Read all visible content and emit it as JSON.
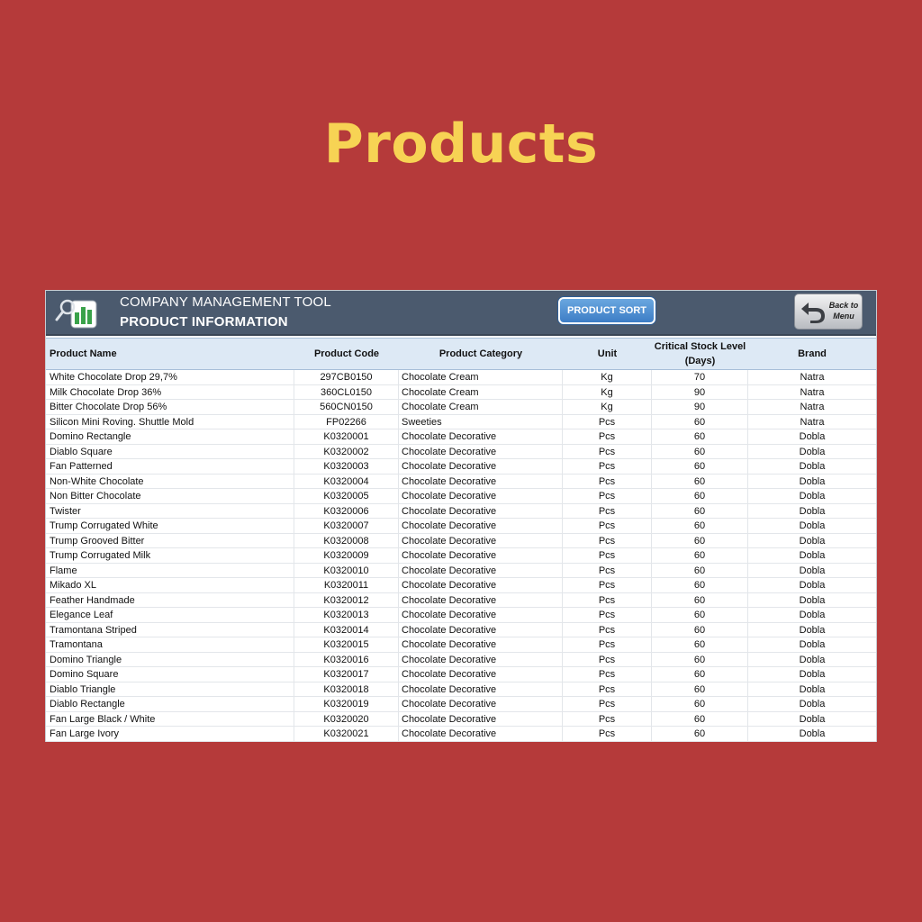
{
  "page": {
    "title": "Products"
  },
  "app": {
    "title_line1": "COMPANY MANAGEMENT TOOL",
    "title_line2": "PRODUCT INFORMATION",
    "logo_icon": "chart-magnifier-icon",
    "sort_button_label": "PRODUCT SORT",
    "back_button_label_line1": "Back to",
    "back_button_label_line2": "Menu",
    "back_icon": "back-arrow-icon"
  },
  "colors": {
    "background": "#b53a3a",
    "title": "#f7d354",
    "header_bar": "#4b5a6e",
    "table_header": "#dde9f5",
    "sort_button": "#3d7dc6"
  },
  "table": {
    "columns": {
      "name": "Product Name",
      "code": "Product Code",
      "category": "Product Category",
      "unit": "Unit",
      "critical_line1": "Critical Stock Level",
      "critical_line2": "(Days)",
      "brand": "Brand"
    },
    "rows": [
      {
        "name": "White Chocolate Drop 29,7%",
        "code": "297CB0150",
        "category": "Chocolate Cream",
        "unit": "Kg",
        "critical": "70",
        "brand": "Natra"
      },
      {
        "name": "Milk Chocolate Drop 36%",
        "code": "360CL0150",
        "category": "Chocolate Cream",
        "unit": "Kg",
        "critical": "90",
        "brand": "Natra"
      },
      {
        "name": "Bitter Chocolate Drop 56%",
        "code": "560CN0150",
        "category": "Chocolate Cream",
        "unit": "Kg",
        "critical": "90",
        "brand": "Natra"
      },
      {
        "name": "Silicon Mini Roving. Shuttle Mold",
        "code": "FP02266",
        "category": "Sweeties",
        "unit": "Pcs",
        "critical": "60",
        "brand": "Natra"
      },
      {
        "name": "Domino Rectangle",
        "code": "K0320001",
        "category": "Chocolate Decorative",
        "unit": "Pcs",
        "critical": "60",
        "brand": "Dobla"
      },
      {
        "name": "Diablo Square",
        "code": "K0320002",
        "category": "Chocolate Decorative",
        "unit": "Pcs",
        "critical": "60",
        "brand": "Dobla"
      },
      {
        "name": "Fan Patterned",
        "code": "K0320003",
        "category": "Chocolate Decorative",
        "unit": "Pcs",
        "critical": "60",
        "brand": "Dobla"
      },
      {
        "name": "Non-White Chocolate",
        "code": "K0320004",
        "category": "Chocolate Decorative",
        "unit": "Pcs",
        "critical": "60",
        "brand": "Dobla"
      },
      {
        "name": "Non Bitter Chocolate",
        "code": "K0320005",
        "category": "Chocolate Decorative",
        "unit": "Pcs",
        "critical": "60",
        "brand": "Dobla"
      },
      {
        "name": "Twister",
        "code": "K0320006",
        "category": "Chocolate Decorative",
        "unit": "Pcs",
        "critical": "60",
        "brand": "Dobla"
      },
      {
        "name": "Trump Corrugated White",
        "code": "K0320007",
        "category": "Chocolate Decorative",
        "unit": "Pcs",
        "critical": "60",
        "brand": "Dobla"
      },
      {
        "name": "Trump Grooved Bitter",
        "code": "K0320008",
        "category": "Chocolate Decorative",
        "unit": "Pcs",
        "critical": "60",
        "brand": "Dobla"
      },
      {
        "name": "Trump Corrugated Milk",
        "code": "K0320009",
        "category": "Chocolate Decorative",
        "unit": "Pcs",
        "critical": "60",
        "brand": "Dobla"
      },
      {
        "name": "Flame",
        "code": "K0320010",
        "category": "Chocolate Decorative",
        "unit": "Pcs",
        "critical": "60",
        "brand": "Dobla"
      },
      {
        "name": "Mikado XL",
        "code": "K0320011",
        "category": "Chocolate Decorative",
        "unit": "Pcs",
        "critical": "60",
        "brand": "Dobla"
      },
      {
        "name": "Feather Handmade",
        "code": "K0320012",
        "category": "Chocolate Decorative",
        "unit": "Pcs",
        "critical": "60",
        "brand": "Dobla"
      },
      {
        "name": "Elegance Leaf",
        "code": "K0320013",
        "category": "Chocolate Decorative",
        "unit": "Pcs",
        "critical": "60",
        "brand": "Dobla"
      },
      {
        "name": "Tramontana Striped",
        "code": "K0320014",
        "category": "Chocolate Decorative",
        "unit": "Pcs",
        "critical": "60",
        "brand": "Dobla"
      },
      {
        "name": "Tramontana",
        "code": "K0320015",
        "category": "Chocolate Decorative",
        "unit": "Pcs",
        "critical": "60",
        "brand": "Dobla"
      },
      {
        "name": "Domino Triangle",
        "code": "K0320016",
        "category": "Chocolate Decorative",
        "unit": "Pcs",
        "critical": "60",
        "brand": "Dobla"
      },
      {
        "name": "Domino Square",
        "code": "K0320017",
        "category": "Chocolate Decorative",
        "unit": "Pcs",
        "critical": "60",
        "brand": "Dobla"
      },
      {
        "name": "Diablo Triangle",
        "code": "K0320018",
        "category": "Chocolate Decorative",
        "unit": "Pcs",
        "critical": "60",
        "brand": "Dobla"
      },
      {
        "name": "Diablo Rectangle",
        "code": "K0320019",
        "category": "Chocolate Decorative",
        "unit": "Pcs",
        "critical": "60",
        "brand": "Dobla"
      },
      {
        "name": "Fan Large Black / White",
        "code": "K0320020",
        "category": "Chocolate Decorative",
        "unit": "Pcs",
        "critical": "60",
        "brand": "Dobla"
      },
      {
        "name": "Fan Large Ivory",
        "code": "K0320021",
        "category": "Chocolate Decorative",
        "unit": "Pcs",
        "critical": "60",
        "brand": "Dobla"
      }
    ]
  }
}
